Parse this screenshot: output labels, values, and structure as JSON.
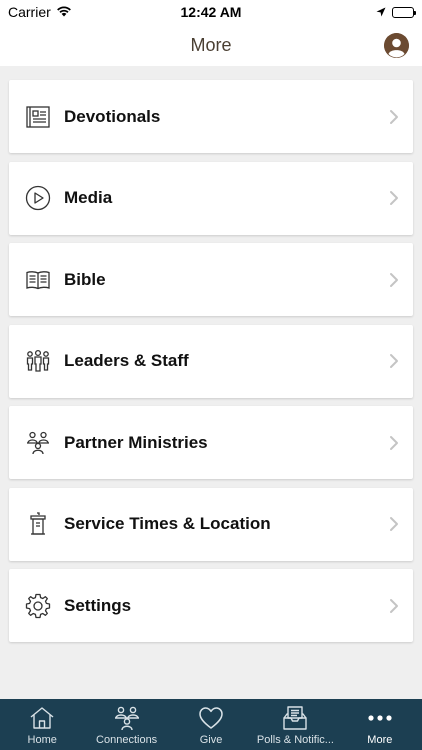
{
  "status": {
    "carrier": "Carrier",
    "time": "12:42 AM"
  },
  "header": {
    "title": "More"
  },
  "menu": [
    {
      "label": "Devotionals",
      "icon": "book-page-icon"
    },
    {
      "label": "Media",
      "icon": "play-circle-icon"
    },
    {
      "label": "Bible",
      "icon": "open-book-icon"
    },
    {
      "label": "Leaders & Staff",
      "icon": "people-group-icon"
    },
    {
      "label": "Partner Ministries",
      "icon": "partners-icon"
    },
    {
      "label": "Service Times & Location",
      "icon": "podium-icon"
    },
    {
      "label": "Settings",
      "icon": "gear-icon"
    }
  ],
  "tabs": [
    {
      "label": "Home",
      "icon": "home-icon"
    },
    {
      "label": "Connections",
      "icon": "connections-icon"
    },
    {
      "label": "Give",
      "icon": "heart-icon"
    },
    {
      "label": "Polls & Notific...",
      "icon": "inbox-icon"
    },
    {
      "label": "More",
      "icon": "more-dots-icon"
    }
  ],
  "colors": {
    "tab_bar_bg": "#1c3f52",
    "title_color": "#4a3f32",
    "page_bg": "#efefef"
  }
}
